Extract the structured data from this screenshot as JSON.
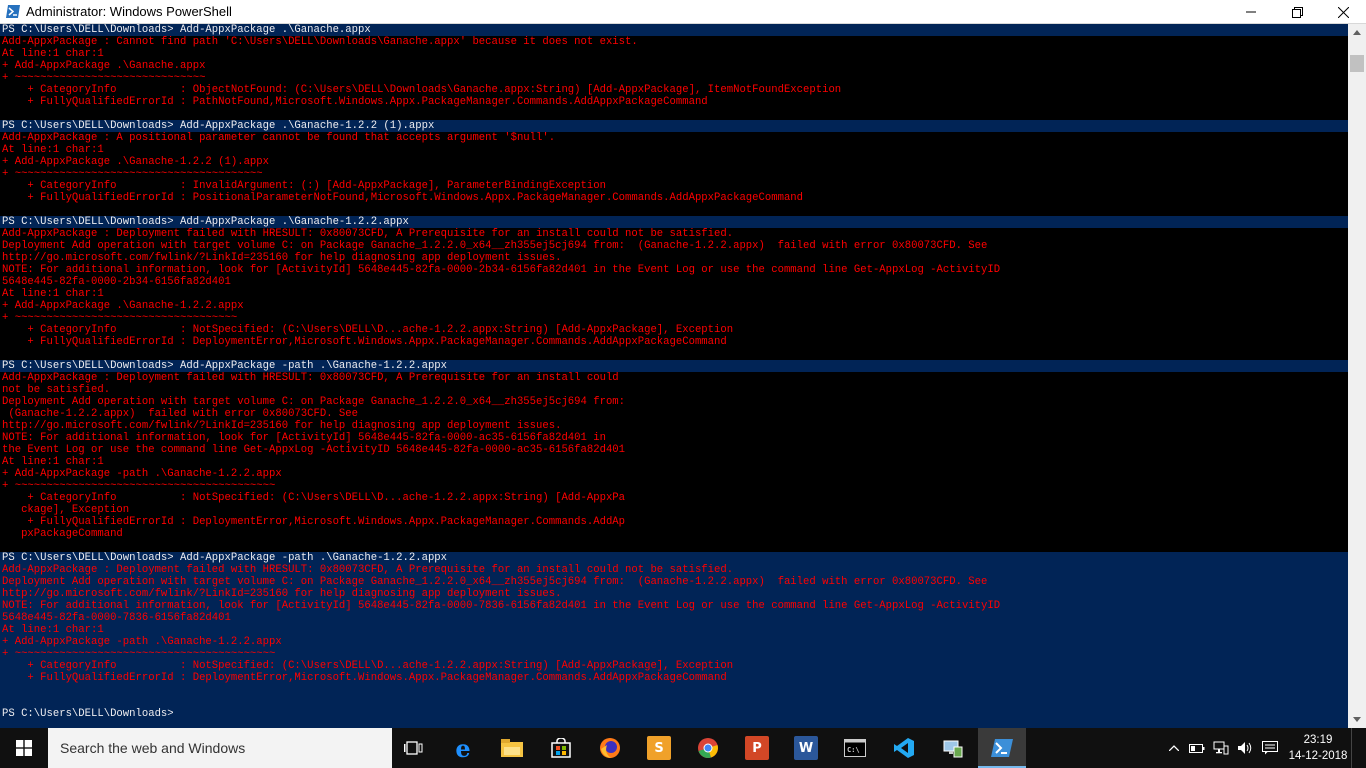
{
  "window": {
    "title": "Administrator: Windows PowerShell"
  },
  "console": {
    "lines": [
      {
        "t": "PS C:\\Users\\DELL\\Downloads> Add-AppxPackage .\\Ganache.appx",
        "k": "prompt"
      },
      {
        "t": "Add-AppxPackage : Cannot find path 'C:\\Users\\DELL\\Downloads\\Ganache.appx' because it does not exist.",
        "k": "err"
      },
      {
        "t": "At line:1 char:1",
        "k": "err"
      },
      {
        "t": "+ Add-AppxPackage .\\Ganache.appx",
        "k": "err"
      },
      {
        "t": "+ ~~~~~~~~~~~~~~~~~~~~~~~~~~~~~~",
        "k": "err"
      },
      {
        "t": "    + CategoryInfo          : ObjectNotFound: (C:\\Users\\DELL\\Downloads\\Ganache.appx:String) [Add-AppxPackage], ItemNotFoundException",
        "k": "err"
      },
      {
        "t": "    + FullyQualifiedErrorId : PathNotFound,Microsoft.Windows.Appx.PackageManager.Commands.AddAppxPackageCommand",
        "k": "err"
      },
      {
        "t": "",
        "k": "blank"
      },
      {
        "t": "PS C:\\Users\\DELL\\Downloads> Add-AppxPackage .\\Ganache-1.2.2 (1).appx",
        "k": "prompt"
      },
      {
        "t": "Add-AppxPackage : A positional parameter cannot be found that accepts argument '$null'.",
        "k": "err"
      },
      {
        "t": "At line:1 char:1",
        "k": "err"
      },
      {
        "t": "+ Add-AppxPackage .\\Ganache-1.2.2 (1).appx",
        "k": "err"
      },
      {
        "t": "+ ~~~~~~~~~~~~~~~~~~~~~~~~~~~~~~~~~~~~~~~",
        "k": "err"
      },
      {
        "t": "    + CategoryInfo          : InvalidArgument: (:) [Add-AppxPackage], ParameterBindingException",
        "k": "err"
      },
      {
        "t": "    + FullyQualifiedErrorId : PositionalParameterNotFound,Microsoft.Windows.Appx.PackageManager.Commands.AddAppxPackageCommand",
        "k": "err"
      },
      {
        "t": "",
        "k": "blank"
      },
      {
        "t": "PS C:\\Users\\DELL\\Downloads> Add-AppxPackage .\\Ganache-1.2.2.appx",
        "k": "prompt"
      },
      {
        "t": "Add-AppxPackage : Deployment failed with HRESULT: 0x80073CFD, A Prerequisite for an install could not be satisfied.",
        "k": "err"
      },
      {
        "t": "Deployment Add operation with target volume C: on Package Ganache_1.2.2.0_x64__zh355ej5cj694 from:  (Ganache-1.2.2.appx)  failed with error 0x80073CFD. See",
        "k": "err"
      },
      {
        "t": "http://go.microsoft.com/fwlink/?LinkId=235160 for help diagnosing app deployment issues.",
        "k": "err"
      },
      {
        "t": "NOTE: For additional information, look for [ActivityId] 5648e445-82fa-0000-2b34-6156fa82d401 in the Event Log or use the command line Get-AppxLog -ActivityID",
        "k": "err"
      },
      {
        "t": "5648e445-82fa-0000-2b34-6156fa82d401",
        "k": "err"
      },
      {
        "t": "At line:1 char:1",
        "k": "err"
      },
      {
        "t": "+ Add-AppxPackage .\\Ganache-1.2.2.appx",
        "k": "err"
      },
      {
        "t": "+ ~~~~~~~~~~~~~~~~~~~~~~~~~~~~~~~~~~~",
        "k": "err"
      },
      {
        "t": "    + CategoryInfo          : NotSpecified: (C:\\Users\\DELL\\D...ache-1.2.2.appx:String) [Add-AppxPackage], Exception",
        "k": "err"
      },
      {
        "t": "    + FullyQualifiedErrorId : DeploymentError,Microsoft.Windows.Appx.PackageManager.Commands.AddAppxPackageCommand",
        "k": "err"
      },
      {
        "t": "",
        "k": "blank"
      },
      {
        "t": "PS C:\\Users\\DELL\\Downloads> Add-AppxPackage -path .\\Ganache-1.2.2.appx",
        "k": "prompt"
      },
      {
        "t": "Add-AppxPackage : Deployment failed with HRESULT: 0x80073CFD, A Prerequisite for an install could",
        "k": "err"
      },
      {
        "t": "not be satisfied.",
        "k": "err"
      },
      {
        "t": "Deployment Add operation with target volume C: on Package Ganache_1.2.2.0_x64__zh355ej5cj694 from:",
        "k": "err"
      },
      {
        "t": " (Ganache-1.2.2.appx)  failed with error 0x80073CFD. See",
        "k": "err"
      },
      {
        "t": "http://go.microsoft.com/fwlink/?LinkId=235160 for help diagnosing app deployment issues.",
        "k": "err"
      },
      {
        "t": "NOTE: For additional information, look for [ActivityId] 5648e445-82fa-0000-ac35-6156fa82d401 in",
        "k": "err"
      },
      {
        "t": "the Event Log or use the command line Get-AppxLog -ActivityID 5648e445-82fa-0000-ac35-6156fa82d401",
        "k": "err"
      },
      {
        "t": "At line:1 char:1",
        "k": "err"
      },
      {
        "t": "+ Add-AppxPackage -path .\\Ganache-1.2.2.appx",
        "k": "err"
      },
      {
        "t": "+ ~~~~~~~~~~~~~~~~~~~~~~~~~~~~~~~~~~~~~~~~~",
        "k": "err"
      },
      {
        "t": "    + CategoryInfo          : NotSpecified: (C:\\Users\\DELL\\D...ache-1.2.2.appx:String) [Add-AppxPa",
        "k": "err"
      },
      {
        "t": "   ckage], Exception",
        "k": "err"
      },
      {
        "t": "    + FullyQualifiedErrorId : DeploymentError,Microsoft.Windows.Appx.PackageManager.Commands.AddAp",
        "k": "err"
      },
      {
        "t": "   pxPackageCommand",
        "k": "err"
      },
      {
        "t": "",
        "k": "blank"
      },
      {
        "t": "PS C:\\Users\\DELL\\Downloads> Add-AppxPackage -path .\\Ganache-1.2.2.appx",
        "k": "prompt"
      },
      {
        "t": "Add-AppxPackage : Deployment failed with HRESULT: 0x80073CFD, A Prerequisite for an install could not be satisfied.",
        "k": "err"
      },
      {
        "t": "Deployment Add operation with target volume C: on Package Ganache_1.2.2.0_x64__zh355ej5cj694 from:  (Ganache-1.2.2.appx)  failed with error 0x80073CFD. See",
        "k": "err"
      },
      {
        "t": "http://go.microsoft.com/fwlink/?LinkId=235160 for help diagnosing app deployment issues.",
        "k": "err"
      },
      {
        "t": "NOTE: For additional information, look for [ActivityId] 5648e445-82fa-0000-7836-6156fa82d401 in the Event Log or use the command line Get-AppxLog -ActivityID",
        "k": "err"
      },
      {
        "t": "5648e445-82fa-0000-7836-6156fa82d401",
        "k": "err"
      },
      {
        "t": "At line:1 char:1",
        "k": "err"
      },
      {
        "t": "+ Add-AppxPackage -path .\\Ganache-1.2.2.appx",
        "k": "err"
      },
      {
        "t": "+ ~~~~~~~~~~~~~~~~~~~~~~~~~~~~~~~~~~~~~~~~~",
        "k": "err"
      },
      {
        "t": "    + CategoryInfo          : NotSpecified: (C:\\Users\\DELL\\D...ache-1.2.2.appx:String) [Add-AppxPackage], Exception",
        "k": "err"
      },
      {
        "t": "    + FullyQualifiedErrorId : DeploymentError,Microsoft.Windows.Appx.PackageManager.Commands.AddAppxPackageCommand",
        "k": "err"
      },
      {
        "t": "",
        "k": "blank"
      },
      {
        "t": "",
        "k": "blank"
      },
      {
        "t": "PS C:\\Users\\DELL\\Downloads>",
        "k": "prompt"
      }
    ],
    "black_rows": [
      1,
      2,
      3,
      4,
      5,
      6,
      7,
      9,
      10,
      11,
      12,
      13,
      14,
      15,
      17,
      18,
      19,
      20,
      21,
      22,
      23,
      24,
      25,
      26,
      27,
      29,
      30,
      31,
      32,
      33,
      34,
      35,
      36,
      37,
      38,
      39,
      40,
      41,
      42,
      43
    ]
  },
  "taskbar": {
    "search_placeholder": "Search the web and Windows",
    "apps": [
      {
        "name": "task-view-icon",
        "label": "",
        "color": "#ffffff"
      },
      {
        "name": "edge-icon",
        "label": "e",
        "color": "#1e90ff"
      },
      {
        "name": "file-explorer-icon",
        "label": "",
        "color": "#f5c342"
      },
      {
        "name": "store-icon",
        "label": "",
        "color": "#ffffff"
      },
      {
        "name": "firefox-icon",
        "label": "",
        "color": "#ff7a18"
      },
      {
        "name": "sublime-text-icon",
        "label": "S",
        "color": "#f0a12a"
      },
      {
        "name": "chrome-icon",
        "label": "",
        "color": "#34a853"
      },
      {
        "name": "powerpoint-icon",
        "label": "P",
        "color": "#d24726"
      },
      {
        "name": "word-icon",
        "label": "W",
        "color": "#2b579a"
      },
      {
        "name": "command-prompt-icon",
        "label": "C:\\",
        "color": "#cccccc"
      },
      {
        "name": "visual-studio-code-icon",
        "label": "",
        "color": "#23a9f2"
      },
      {
        "name": "network-admin-icon",
        "label": "",
        "color": "#9ec7e8"
      },
      {
        "name": "powershell-icon",
        "label": ">_",
        "color": "#3c8fd8"
      }
    ],
    "clock_time": "23:19",
    "clock_date": "14-12-2018"
  },
  "colors": {
    "console_bg": "#012456",
    "error_text": "#ff0000",
    "prompt_text": "#eeedf0",
    "taskbar_bg": "#101010"
  }
}
